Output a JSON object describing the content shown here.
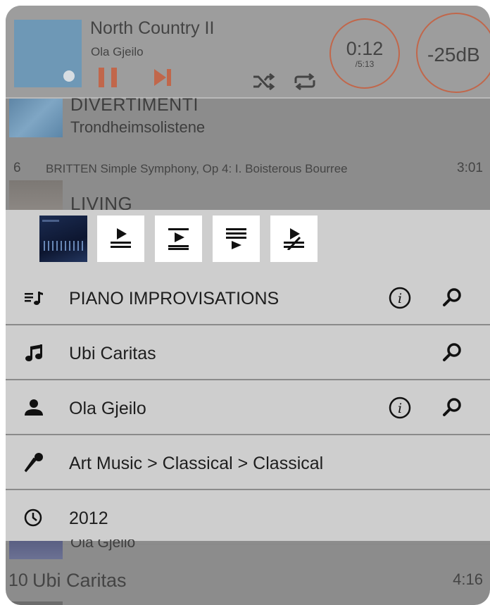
{
  "now_playing": {
    "title": "North Country II",
    "artist": "Ola Gjeilo",
    "time_current": "0:12",
    "time_total": "/5:13",
    "volume": "-25dB"
  },
  "queue": {
    "item_a": {
      "album": "DIVERTIMENTI",
      "artist": "Trondheimsolistene"
    },
    "track_6": {
      "number": "6",
      "title": "BRITTEN Simple Symphony, Op 4: I. Boisterous Bourree",
      "duration": "3:01"
    },
    "item_b": {
      "album": "LIVING"
    },
    "item_c": {
      "artist": "Ola Gjeilo"
    },
    "track_10": {
      "number": "10",
      "title": "Ubi Caritas",
      "duration": "4:16"
    }
  },
  "details": {
    "album": "PIANO IMPROVISATIONS",
    "track": "Ubi Caritas",
    "artist": "Ola Gjeilo",
    "genre": "Art Music > Classical > Classical",
    "year": "2012"
  },
  "colors": {
    "accent": "#c1674b",
    "overlay_bg": "#cecece",
    "header_bg": "#9d9d9d"
  },
  "icons": [
    "pause-icon",
    "next-icon",
    "shuffle-icon",
    "repeat-icon",
    "play-now-icon",
    "play-next-icon",
    "add-to-queue-icon",
    "clear-and-play-icon",
    "playlist-icon",
    "music-note-icon",
    "person-icon",
    "microphone-icon",
    "clock-icon",
    "info-icon",
    "search-icon"
  ]
}
